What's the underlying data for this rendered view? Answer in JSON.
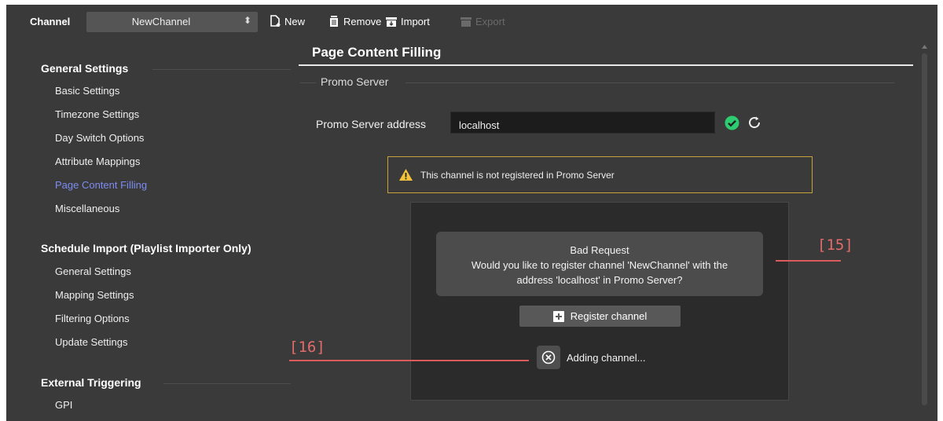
{
  "toolbar": {
    "channel_label": "Channel",
    "channel_value": "NewChannel",
    "new_label": "New",
    "remove_label": "Remove",
    "import_label": "Import",
    "export_label": "Export"
  },
  "sidebar": {
    "sections": [
      {
        "title": "General Settings",
        "items": [
          "Basic Settings",
          "Timezone Settings",
          "Day Switch Options",
          "Attribute Mappings",
          "Page Content Filling",
          "Miscellaneous"
        ]
      },
      {
        "title": "Schedule Import (Playlist Importer Only)",
        "items": [
          "General Settings",
          "Mapping Settings",
          "Filtering Options",
          "Update Settings"
        ]
      },
      {
        "title": "External Triggering",
        "items": [
          "GPI"
        ]
      }
    ],
    "active_item": "Page Content Filling"
  },
  "main": {
    "page_title": "Page Content Filling",
    "group_title": "Promo Server",
    "address_label": "Promo Server address",
    "address_value": "localhost",
    "warning_text": "This channel is not registered in Promo Server",
    "dialog": {
      "message_line1": "Bad Request",
      "message_line2": "Would you like to register channel 'NewChannel' with the",
      "message_line3": "address 'localhost' in Promo Server?",
      "register_label": "Register channel",
      "progress_label": "Adding channel..."
    }
  },
  "annotations": {
    "a15": "[15]",
    "a16": "[16]"
  },
  "colors": {
    "background": "#3a3a3a",
    "active_nav": "#7c8cf0",
    "warning_border": "#c7a23a",
    "success": "#2ecc71",
    "annotation": "#e26b6b"
  }
}
